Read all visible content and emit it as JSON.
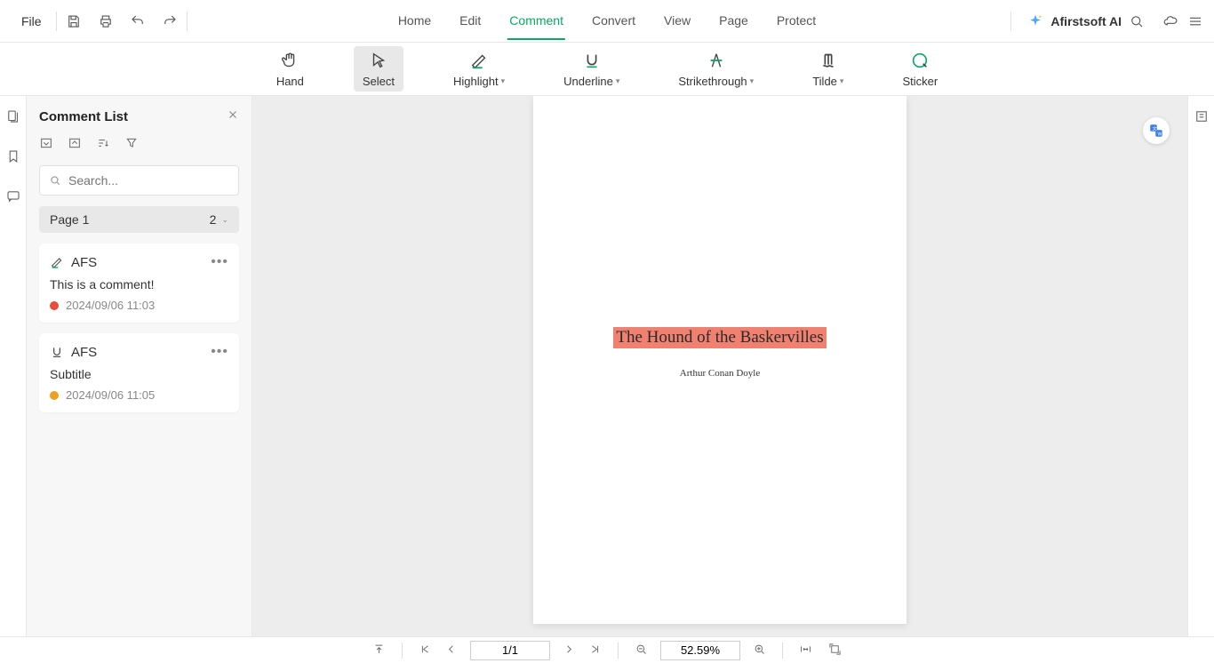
{
  "topbar": {
    "file_label": "File",
    "tabs": [
      "Home",
      "Edit",
      "Comment",
      "Convert",
      "View",
      "Page",
      "Protect"
    ],
    "active_tab_index": 2,
    "ai_label": "Afirstsoft AI"
  },
  "toolbar": {
    "items": [
      {
        "label": "Hand",
        "active": false,
        "dropdown": false
      },
      {
        "label": "Select",
        "active": true,
        "dropdown": false
      },
      {
        "label": "Highlight",
        "active": false,
        "dropdown": true
      },
      {
        "label": "Underline",
        "active": false,
        "dropdown": true
      },
      {
        "label": "Strikethrough",
        "active": false,
        "dropdown": true
      },
      {
        "label": "Tilde",
        "active": false,
        "dropdown": true
      },
      {
        "label": "Sticker",
        "active": false,
        "dropdown": false
      }
    ]
  },
  "comment_panel": {
    "title": "Comment List",
    "search_placeholder": "Search...",
    "page_group": {
      "label": "Page 1",
      "count": "2"
    },
    "comments": [
      {
        "icon": "highlight",
        "user": "AFS",
        "text": "This is a comment!",
        "dot_color": "#e84c3d",
        "time": "2024/09/06 11:03"
      },
      {
        "icon": "underline",
        "user": "AFS",
        "text": "Subtitle",
        "dot_color": "#f0a020",
        "time": "2024/09/06 11:05"
      }
    ]
  },
  "document": {
    "title": "The Hound of the Baskervilles",
    "author": "Arthur Conan Doyle"
  },
  "bottombar": {
    "page_display": "1/1",
    "zoom": "52.59%"
  }
}
